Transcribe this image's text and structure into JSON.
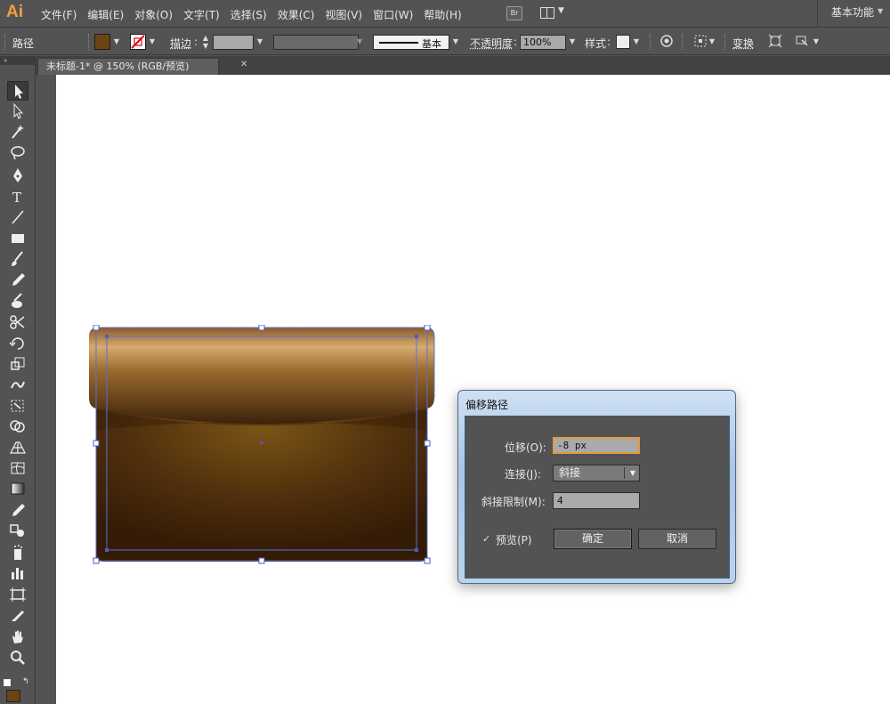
{
  "app": {
    "logo": "Ai"
  },
  "menubar": {
    "items": [
      "文件(F)",
      "编辑(E)",
      "对象(O)",
      "文字(T)",
      "选择(S)",
      "效果(C)",
      "视图(V)",
      "窗口(W)",
      "帮助(H)"
    ],
    "bridge_label": "Br",
    "workspace": "基本功能"
  },
  "controlbar": {
    "selection": "路径",
    "stroke_label": "描边",
    "stroke_profile": "基本",
    "opacity_label": "不透明度",
    "opacity_value": "100%",
    "style_label": "样式",
    "transform_label": "变换",
    "fill_color": "#6b4414"
  },
  "document": {
    "tab_title": "未标题-1* @ 150% (RGB/预览)"
  },
  "dialog": {
    "title": "偏移路径",
    "offset_label": "位移(O):",
    "offset_value": "-8 px",
    "join_label": "连接(J):",
    "join_value": "斜接",
    "miter_label": "斜接限制(M):",
    "miter_value": "4",
    "preview_label": "预览(P)",
    "preview_checked": true,
    "ok_label": "确定",
    "cancel_label": "取消"
  },
  "tools": [
    "selection-tool",
    "direct-selection-tool",
    "magic-wand-tool",
    "lasso-tool",
    "pen-tool",
    "type-tool",
    "line-segment-tool",
    "rectangle-tool",
    "paintbrush-tool",
    "pencil-tool",
    "blob-brush-tool",
    "scissors-tool",
    "rotate-tool",
    "scale-tool",
    "warp-tool",
    "free-transform-tool",
    "shape-builder-tool",
    "perspective-grid-tool",
    "mesh-tool",
    "gradient-tool",
    "eyedropper-tool",
    "blend-tool",
    "symbol-sprayer-tool",
    "column-graph-tool",
    "artboard-tool",
    "slice-tool",
    "hand-tool",
    "zoom-tool"
  ]
}
